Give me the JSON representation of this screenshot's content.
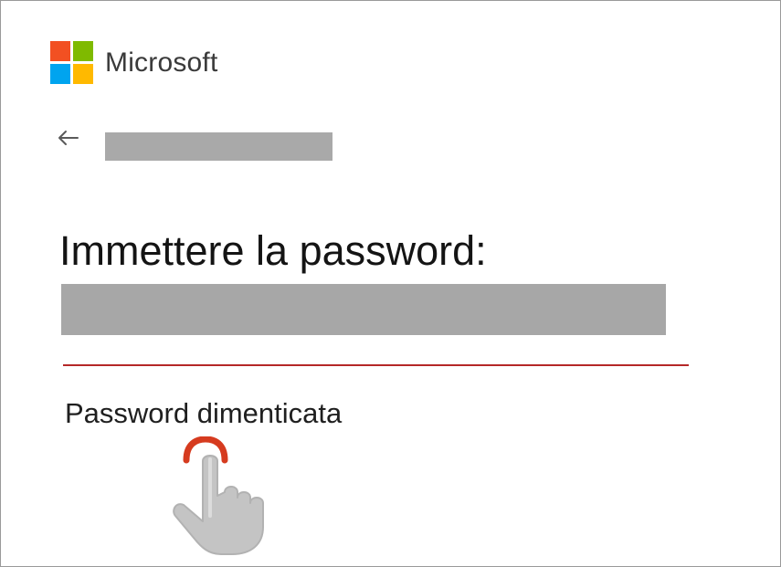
{
  "brand": {
    "name": "Microsoft",
    "logo_colors": [
      "#f25022",
      "#7fba00",
      "#00a4ef",
      "#ffb900"
    ]
  },
  "header": {
    "back_icon": "back-arrow-icon"
  },
  "form": {
    "heading": "Immettere la password:",
    "password_value": "",
    "forgot_password_link": "Password dimenticata",
    "accent_color": "#b52828"
  },
  "overlay": {
    "pointer_icon": "hand-pointer-icon",
    "click_indicator_color": "#d63b1f"
  }
}
